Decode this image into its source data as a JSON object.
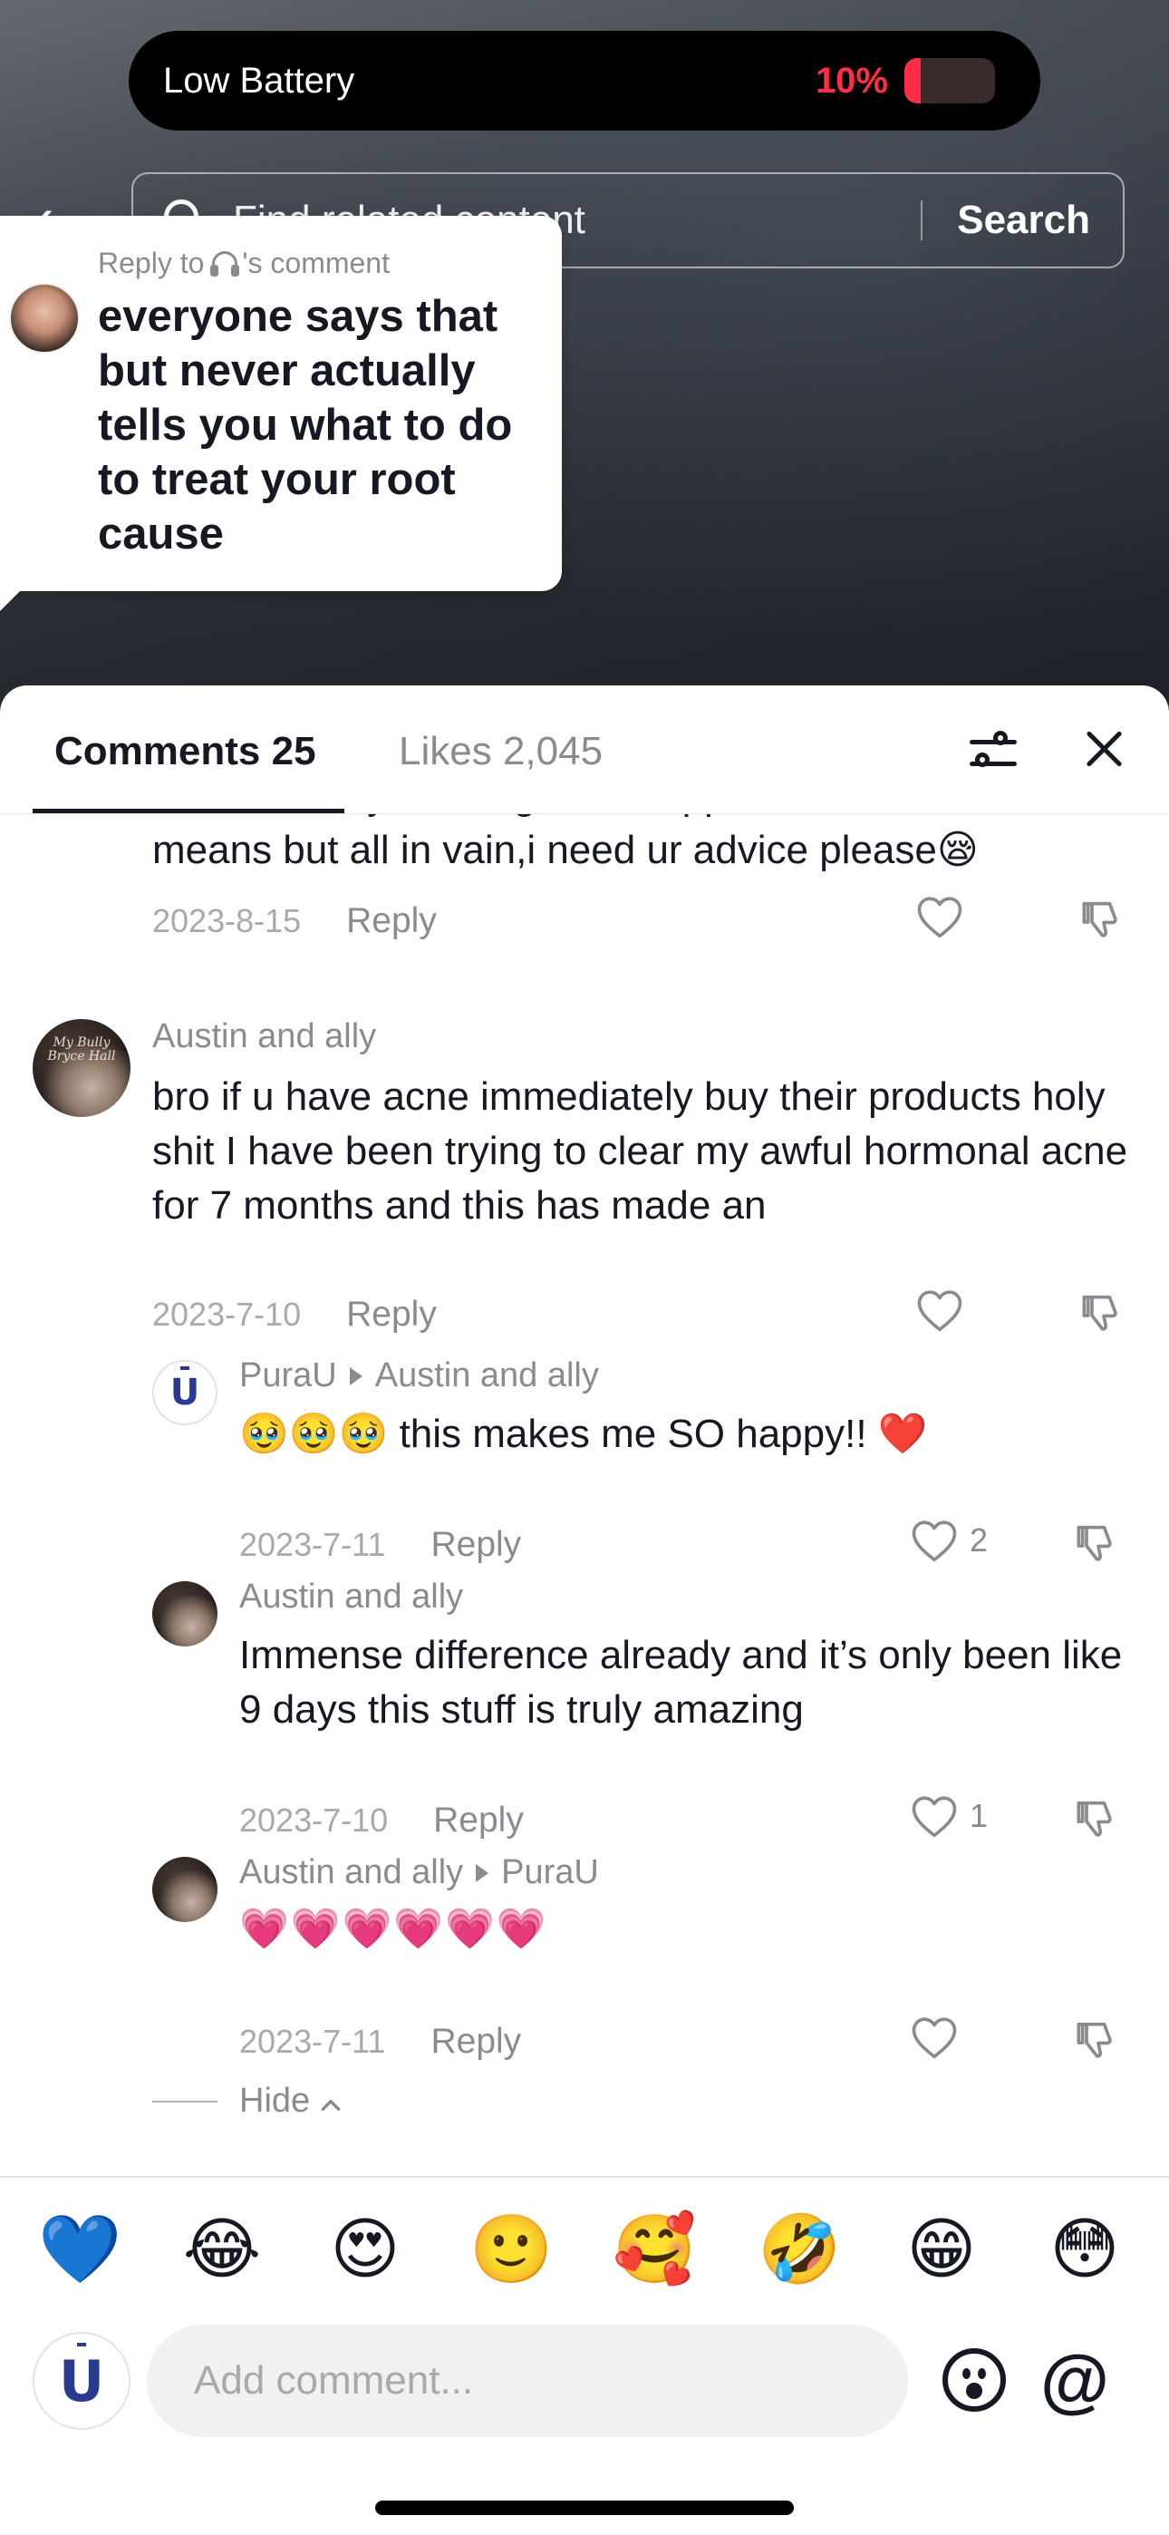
{
  "status": {
    "alert_title": "Low Battery",
    "battery_percent": "10%",
    "battery_level": 0.1,
    "alert_color": "#ff2d46"
  },
  "search": {
    "placeholder": "Find related content",
    "button_label": "Search"
  },
  "reply_sticker": {
    "prefix": "Reply to",
    "suffix": "'s comment",
    "text": "everyone says that but never actually tells you what to do to treat your root cause"
  },
  "sheet": {
    "tab_comments": "Comments 25",
    "tab_likes": "Likes 2,045"
  },
  "comments": [
    {
      "text_top": "even feel shy working around pple,have tried all",
      "text": "means but all in vain,i need ur advice please😪",
      "date": "2023-8-15",
      "reply_label": "Reply"
    },
    {
      "user": "Austin and ally",
      "avatar_text": "My Bully Bryce Hall",
      "text": "bro if u have acne immediately buy their products holy shit I have been trying to clear my awful hormonal acne for 7 months and this has made an",
      "date": "2023-7-10",
      "reply_label": "Reply"
    }
  ],
  "replies": [
    {
      "user": "PuraU",
      "reply_to": "Austin and ally",
      "text": "🥹🥹🥹 this makes me SO happy!! ❤️",
      "date": "2023-7-11",
      "reply_label": "Reply",
      "likes": "2"
    },
    {
      "user": "Austin and ally",
      "text": "Immense difference already and it’s only been like 9 days this stuff is truly amazing",
      "date": "2023-7-10",
      "reply_label": "Reply",
      "likes": "1"
    },
    {
      "user": "Austin and ally",
      "reply_to": "PuraU",
      "text": "💗💗💗💗💗💗",
      "date": "2023-7-11",
      "reply_label": "Reply"
    }
  ],
  "hide_label": "Hide",
  "brand_letter": "U",
  "quick_emojis": [
    "💙",
    "😂",
    "😍",
    "🙂",
    "🥰",
    "🤣",
    "😁",
    "😳"
  ],
  "composer": {
    "placeholder": "Add comment...",
    "mention_symbol": "@"
  },
  "icons": {
    "back": "chevron-left-icon",
    "search": "search-icon",
    "filter": "sliders-icon",
    "close": "close-icon",
    "like": "heart-icon",
    "dislike": "thumbs-down-icon",
    "emoji_picker": "emoji-face-icon",
    "mention": "at-icon"
  }
}
